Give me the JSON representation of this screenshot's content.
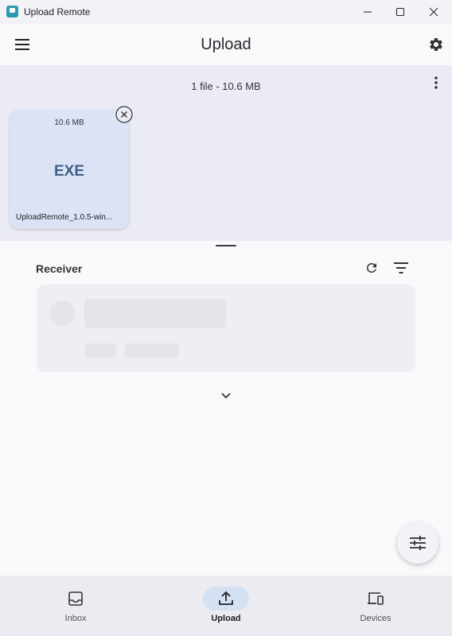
{
  "window": {
    "title": "Upload Remote",
    "controls": [
      "minimize-icon",
      "maximize-icon",
      "close-icon"
    ]
  },
  "appbar": {
    "title": "Upload",
    "menu_icon": "hamburger-menu-icon",
    "settings_icon": "gear-icon"
  },
  "files": {
    "summary": "1 file - 10.6 MB",
    "more_icon": "more-vertical-icon",
    "items": [
      {
        "size": "10.6 MB",
        "type": "EXE",
        "name": "UploadRemote_1.0.5-win..."
      }
    ]
  },
  "receiver": {
    "label": "Receiver",
    "refresh_icon": "refresh-icon",
    "filter_icon": "filter-icon",
    "expand_icon": "chevron-down-icon"
  },
  "fab": {
    "icon": "tune-icon"
  },
  "nav": {
    "items": [
      {
        "label": "Inbox",
        "icon": "inbox-icon",
        "active": false
      },
      {
        "label": "Upload",
        "icon": "upload-icon",
        "active": true
      },
      {
        "label": "Devices",
        "icon": "devices-icon",
        "active": false
      }
    ]
  },
  "colors": {
    "accent": "#d3e1f3",
    "file_card": "#dce3f5",
    "file_type_text": "#3d5f8a",
    "panel_background": "#ebebf5"
  }
}
